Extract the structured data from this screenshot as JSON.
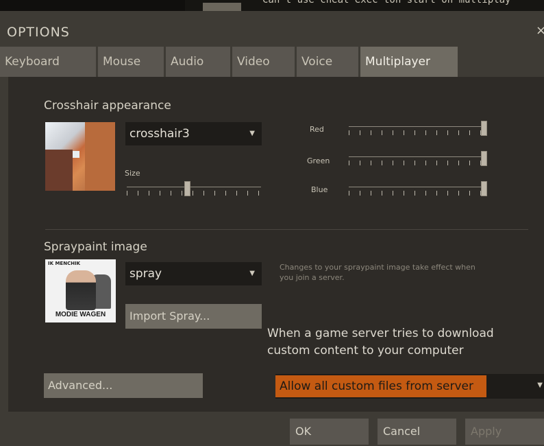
{
  "background": {
    "console_text": "Can't use cheat exec ton start on multiplay"
  },
  "dialog": {
    "title": "OPTIONS",
    "close_glyph": "×"
  },
  "tabs": [
    {
      "label": "Keyboard"
    },
    {
      "label": "Mouse"
    },
    {
      "label": "Audio"
    },
    {
      "label": "Video"
    },
    {
      "label": "Voice"
    },
    {
      "label": "Multiplayer",
      "active": true
    }
  ],
  "crosshair": {
    "section_label": "Crosshair appearance",
    "selected": "crosshair3",
    "size_label": "Size",
    "size_level": 0.45,
    "red_label": "Red",
    "red_level": 1.0,
    "green_label": "Green",
    "green_level": 1.0,
    "blue_label": "Blue",
    "blue_level": 1.0
  },
  "spray": {
    "section_label": "Spraypaint image",
    "selected": "spray",
    "preview_top_text": "IK MENCHIK",
    "preview_bottom_text": "MODIE WAGEN",
    "hint": "Changes to your spraypaint image take effect when you join a server.",
    "import_button": "Import Spray..."
  },
  "custom_content": {
    "prompt": "When a game server tries to download custom content to your computer",
    "selected": "Allow all custom files from server"
  },
  "advanced_button": "Advanced...",
  "footer": {
    "ok": "OK",
    "cancel": "Cancel",
    "apply": "Apply"
  },
  "colors": {
    "accent_orange": "#c45a12",
    "dialog_bg": "#3e3b35",
    "panel_bg": "#2e2b27"
  }
}
